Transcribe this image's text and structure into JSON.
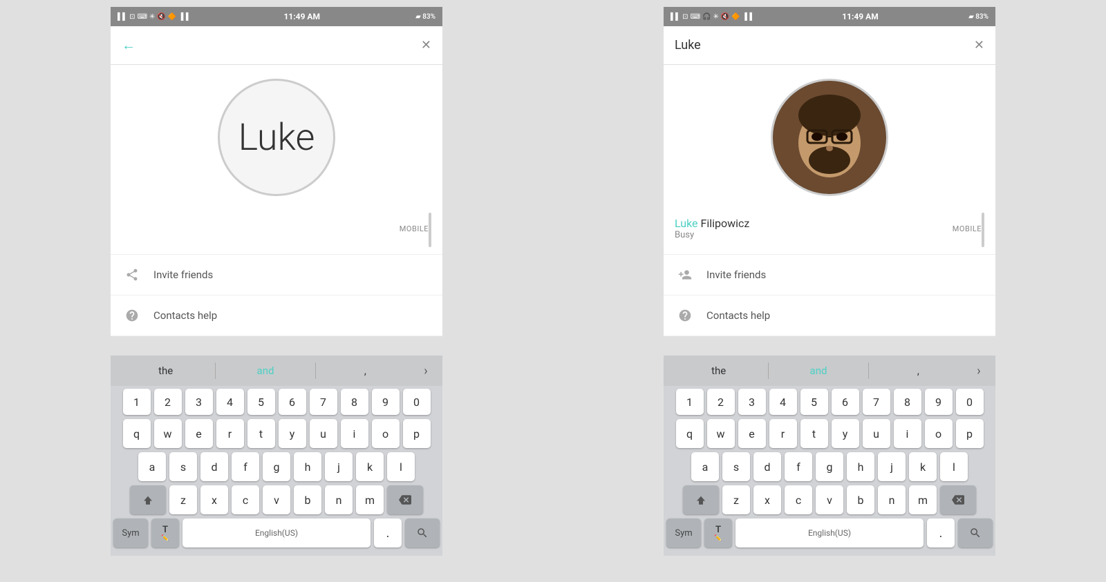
{
  "panel1": {
    "status_bar": {
      "left_icons": "📶 🔵 ⬜ ⬜ 🎵 ✕ 📶",
      "battery": "83%",
      "time": "11:49 AM"
    },
    "header": {
      "back_icon": "←",
      "close_icon": "✕"
    },
    "avatar": {
      "text": "Luke",
      "type": "text"
    },
    "contact_item": {
      "label": "MOBILE"
    },
    "menu_items": [
      {
        "icon": "share",
        "text": "Invite friends"
      },
      {
        "icon": "help",
        "text": "Contacts help"
      }
    ],
    "keyboard": {
      "suggestions": [
        "the",
        "and",
        ","
      ],
      "rows": {
        "numbers": [
          "1",
          "2",
          "3",
          "4",
          "5",
          "6",
          "7",
          "8",
          "9",
          "0"
        ],
        "row1": [
          "q",
          "w",
          "e",
          "r",
          "t",
          "y",
          "u",
          "i",
          "o",
          "p"
        ],
        "row2": [
          "a",
          "s",
          "d",
          "f",
          "g",
          "h",
          "j",
          "k",
          "l"
        ],
        "row3": [
          "z",
          "x",
          "c",
          "v",
          "b",
          "n",
          "m"
        ],
        "space_label": "English(US)"
      }
    }
  },
  "panel2": {
    "status_bar": {
      "left_icons": "📶 🔵 ⬜ 🎧 🔵 ✕ 📶",
      "battery": "83%",
      "time": "11:49 AM"
    },
    "header": {
      "title": "Luke",
      "close_icon": "✕"
    },
    "avatar": {
      "type": "photo"
    },
    "contact_item": {
      "first_name": "Luke",
      "last_name": " Filipowicz",
      "label": "MOBILE",
      "status": "Busy"
    },
    "menu_items": [
      {
        "icon": "person_add",
        "text": "Invite friends"
      },
      {
        "icon": "help",
        "text": "Contacts help"
      }
    ],
    "keyboard": {
      "suggestions": [
        "the",
        "and",
        ","
      ],
      "rows": {
        "numbers": [
          "1",
          "2",
          "3",
          "4",
          "5",
          "6",
          "7",
          "8",
          "9",
          "0"
        ],
        "row1": [
          "q",
          "w",
          "e",
          "r",
          "t",
          "y",
          "u",
          "i",
          "o",
          "p"
        ],
        "row2": [
          "a",
          "s",
          "d",
          "f",
          "g",
          "h",
          "j",
          "k",
          "l"
        ],
        "row3": [
          "z",
          "x",
          "c",
          "v",
          "b",
          "n",
          "m"
        ],
        "space_label": "English(US)"
      }
    }
  },
  "colors": {
    "teal": "#4dd0c4",
    "keyboard_bg": "#d1d3d6",
    "key_bg": "#ffffff",
    "key_special_bg": "#b0b4b8",
    "suggestion_highlight": "#4dd0c4"
  }
}
